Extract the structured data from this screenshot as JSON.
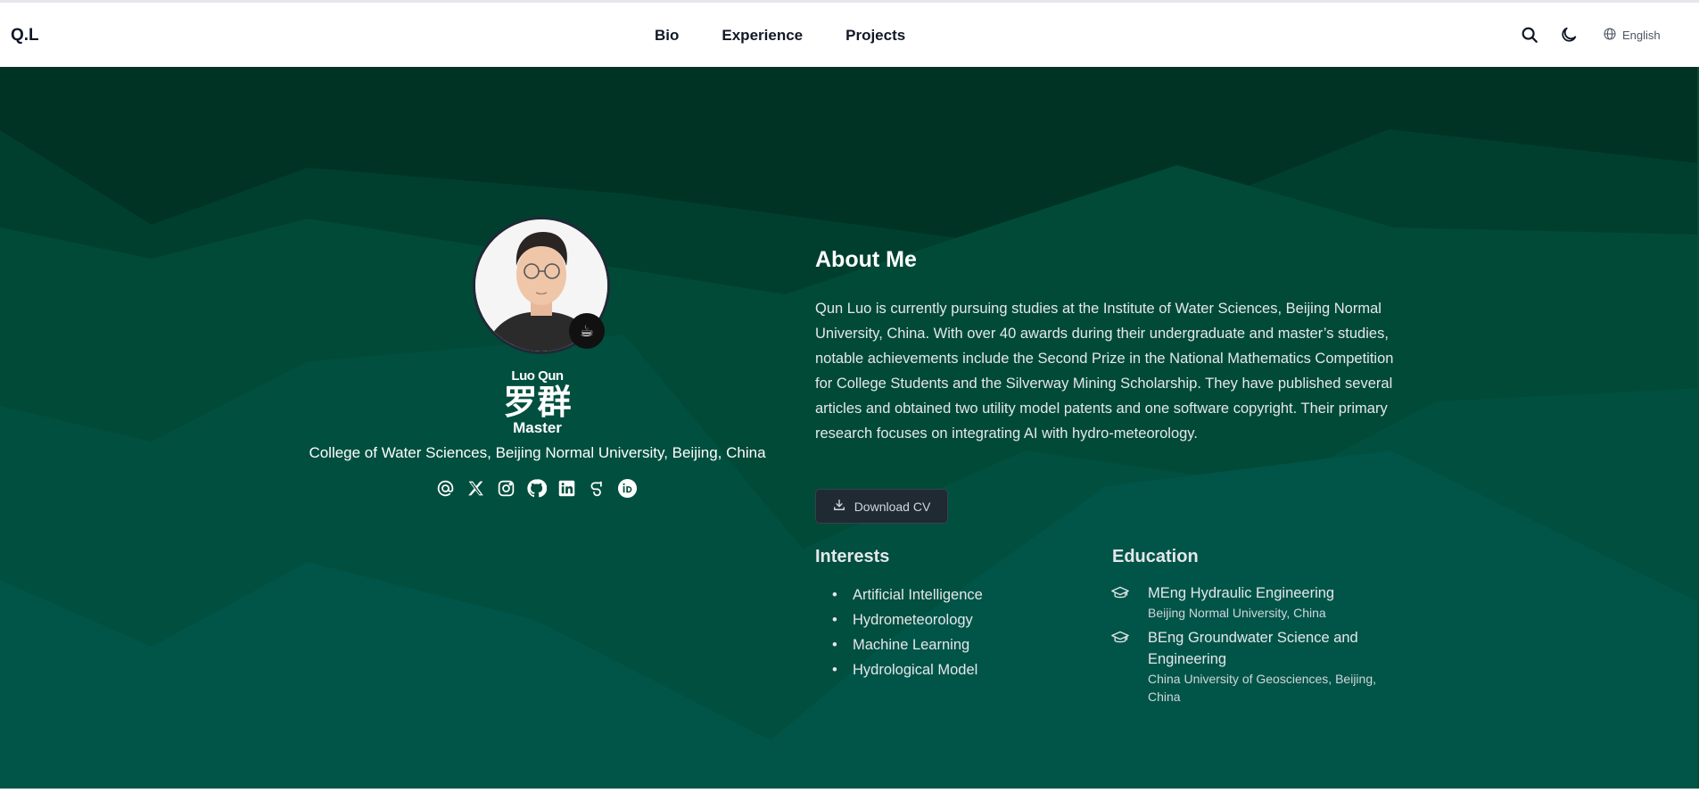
{
  "brand": "Q.L",
  "nav": {
    "links": [
      "Bio",
      "Experience",
      "Projects"
    ],
    "language": "English"
  },
  "profile": {
    "name_en": "Luo Qun",
    "name_zh": "罗群",
    "role": "Master",
    "affiliation": "College of Water Sciences, Beijing Normal University, Beijing, China",
    "socials": [
      "email-icon",
      "x-icon",
      "instagram-icon",
      "github-icon",
      "linkedin-icon",
      "google-scholar-icon",
      "orcid-icon"
    ]
  },
  "about": {
    "title": "About Me",
    "text": "Qun Luo is currently pursuing studies at the Institute of Water Sciences, Beijing Normal University, China. With over 40 awards during their undergraduate and master’s studies, notable achievements include the Second Prize in the National Mathematics Competition for College Students and the Silverway Mining Scholarship. They have published several articles and obtained two utility model patents and one software copyright. Their primary research focuses on integrating AI with hydro-meteorology.",
    "cv_label": "Download CV"
  },
  "interests": {
    "title": "Interests",
    "items": [
      "Artificial Intelligence",
      "Hydrometeorology",
      "Machine Learning",
      "Hydrological Model"
    ]
  },
  "education": {
    "title": "Education",
    "items": [
      {
        "degree": "MEng Hydraulic Engineering",
        "school": "Beijing Normal University, China"
      },
      {
        "degree": "BEng Groundwater Science and Engineering",
        "school": "China University of Geosciences, Beijing, China"
      }
    ]
  },
  "colors": {
    "hero_dark": "#003a28",
    "hero_mid": "#014a38",
    "hero_light": "#015548",
    "accent": "#ffffff"
  }
}
